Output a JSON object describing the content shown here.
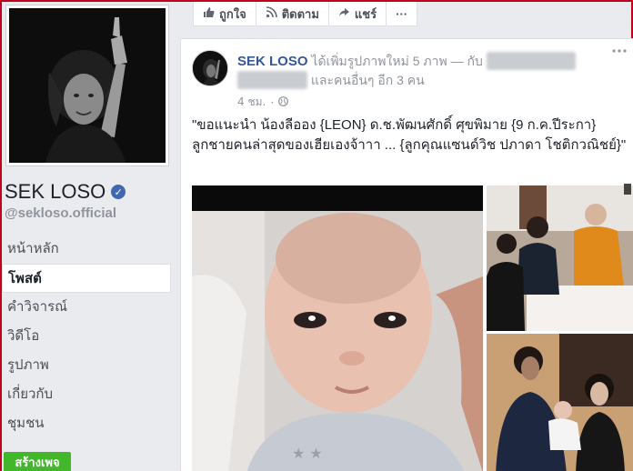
{
  "page": {
    "name": "SEK LOSO",
    "handle": "@sekloso.official",
    "create_page_label": "สร้างเพจ"
  },
  "nav": {
    "items": [
      {
        "label": "หน้าหลัก"
      },
      {
        "label": "โพสต์"
      },
      {
        "label": "คำวิจารณ์"
      },
      {
        "label": "วิดีโอ"
      },
      {
        "label": "รูปภาพ"
      },
      {
        "label": "เกี่ยวกับ"
      },
      {
        "label": "ชุมชน"
      }
    ]
  },
  "actionbar": {
    "like_label": "ถูกใจ",
    "follow_label": "ติดตาม",
    "share_label": "แชร์",
    "more_label": "···"
  },
  "post": {
    "author": "SEK LOSO",
    "action_text": "ได้เพิ่มรูปภาพใหม่ 5 ภาพ — กับ",
    "others_text": "และคนอื่นๆ อีก 3 คน",
    "time": "4 ชม.",
    "body": "\"ขอแนะนำ น้องลีออง {LEON} ด.ช.พัฒนศักดิ์ ศุขพิมาย {9 ก.ค.ปีระกา} ลูกชายคนล่าสุดของเฮียเองจ้าาา ... {ลูกคุณแซนด์วิช ปภาดา โชติกวณิชย์}\"",
    "more_icon": "ellipsis-icon"
  },
  "colors": {
    "link": "#365899",
    "create_button": "#42b72a",
    "background": "#e9ebee"
  }
}
